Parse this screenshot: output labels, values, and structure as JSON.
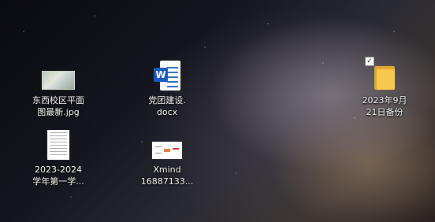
{
  "desktop": {
    "icons": [
      {
        "line1": "东西校区平面",
        "line2": "图最新.jpg",
        "icon": "image-thumbnail-icon"
      },
      {
        "line1": "党团建设.",
        "line2": "docx",
        "icon": "word-document-icon"
      },
      {
        "line1": "2023年9月",
        "line2": "21日备份",
        "icon": "folder-icon"
      },
      {
        "line1": "2023-2024",
        "line2": "学年第一学...",
        "icon": "document-thumbnail-icon"
      },
      {
        "line1": "Xmind",
        "line2": "16887133...",
        "icon": "xmind-thumbnail-icon"
      }
    ],
    "word_badge": "W",
    "colors": {
      "word_blue": "#185abd",
      "folder_yellow": "#f7c84b"
    }
  }
}
